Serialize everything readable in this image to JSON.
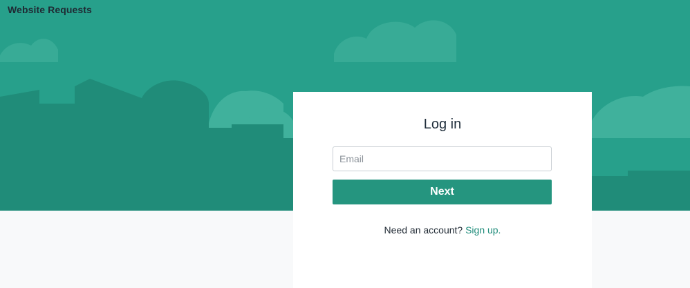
{
  "header": {
    "app_title": "Website Requests"
  },
  "login": {
    "title": "Log in",
    "email_placeholder": "Email",
    "email_value": "",
    "next_label": "Next",
    "signup_prompt": "Need an account?",
    "signup_link": "Sign up."
  },
  "colors": {
    "brand": "#27a08b",
    "button": "#25957f",
    "link": "#1e8c7a",
    "page_background": "#f8f9fa"
  }
}
